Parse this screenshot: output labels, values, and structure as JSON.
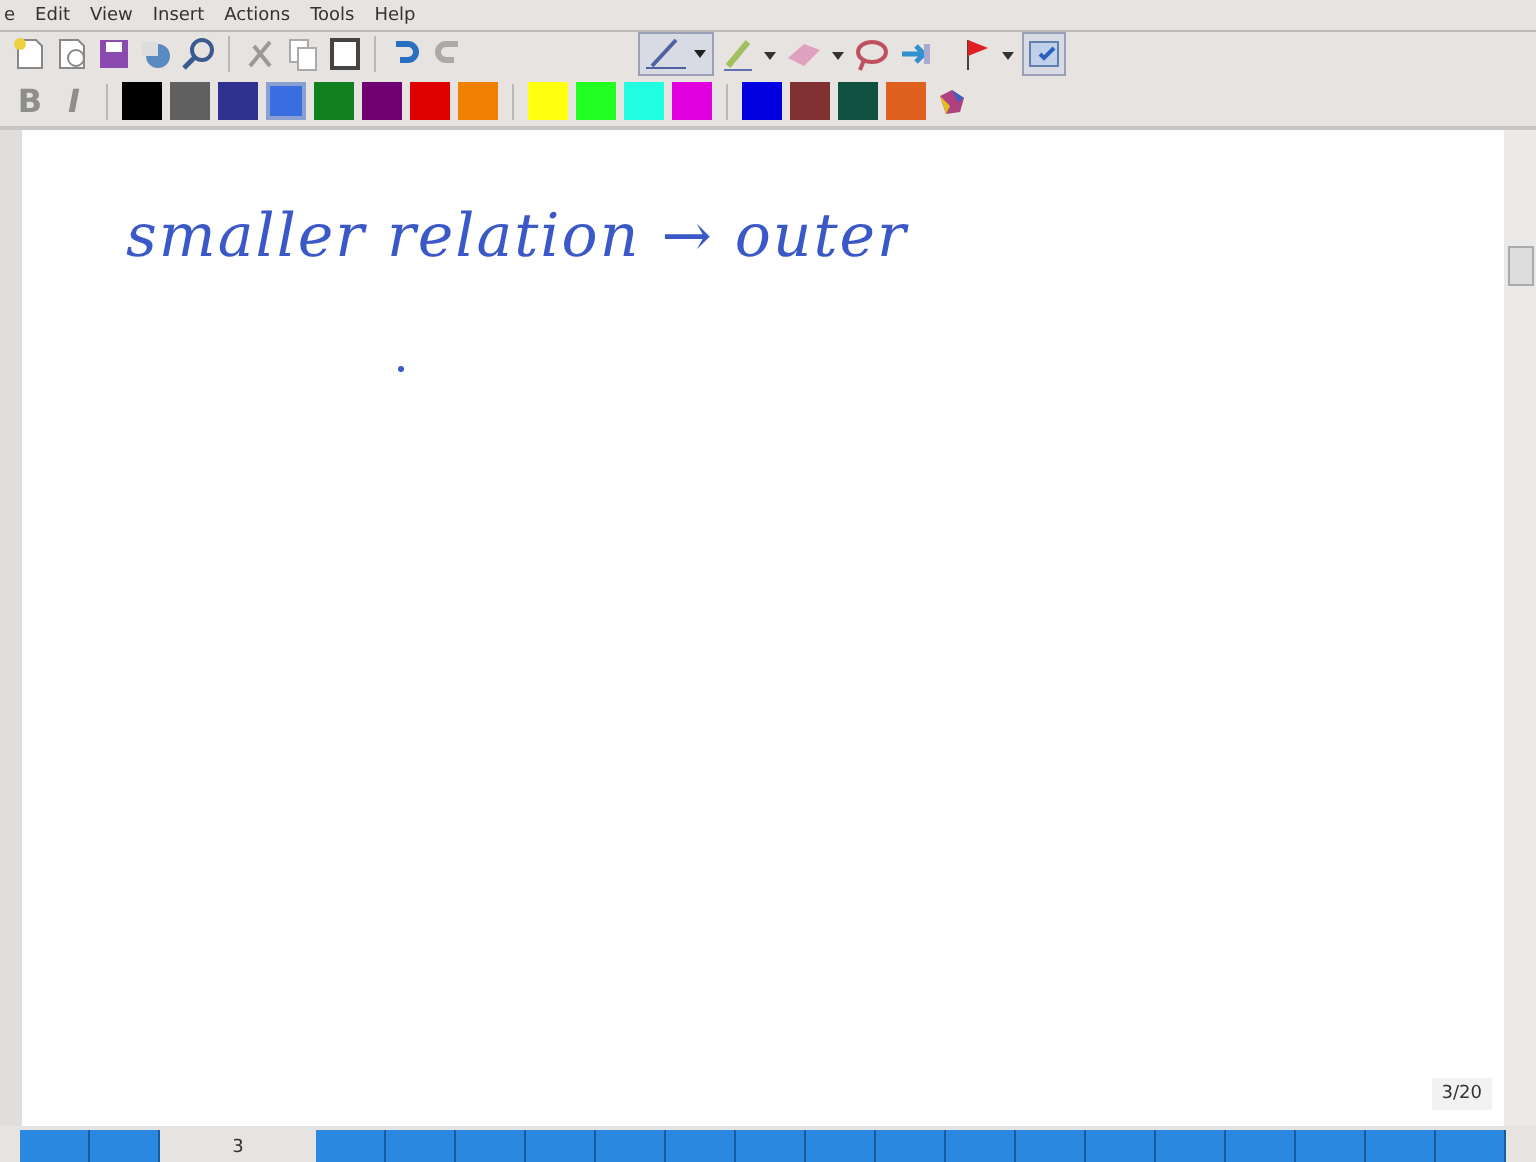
{
  "menu": [
    {
      "label": "e"
    },
    {
      "label": "Edit"
    },
    {
      "label": "View"
    },
    {
      "label": "Insert"
    },
    {
      "label": "Actions"
    },
    {
      "label": "Tools"
    },
    {
      "label": "Help"
    }
  ],
  "format": [
    {
      "label": "B",
      "kind": "bold",
      "disabled": true
    },
    {
      "label": "I",
      "kind": "italic",
      "disabled": true
    }
  ],
  "palette": [
    {
      "color": "#000000",
      "selected": false
    },
    {
      "color": "#606060",
      "selected": false
    },
    {
      "color": "#303090",
      "selected": false
    },
    {
      "color": "#3a6ee0",
      "selected": true
    },
    {
      "color": "#108020",
      "selected": false
    },
    {
      "color": "#700070",
      "selected": false
    },
    {
      "color": "#e00000",
      "selected": false
    },
    {
      "color": "#f08000",
      "selected": false
    },
    {
      "color": "#ffff10",
      "selected": false
    },
    {
      "color": "#20ff20",
      "selected": false
    },
    {
      "color": "#20ffe0",
      "selected": false
    },
    {
      "color": "#e000e0",
      "selected": false
    },
    {
      "color": "#0000e0",
      "selected": false
    },
    {
      "color": "#803030",
      "selected": false
    },
    {
      "color": "#105040",
      "selected": false
    },
    {
      "color": "#e06020",
      "selected": false
    }
  ],
  "ink": {
    "text": "smaller relation → outer",
    "color": "#3a58c8"
  },
  "page_indicator": "3/20",
  "pages": [
    {
      "selected": false
    },
    {
      "selected": false
    },
    {
      "selected": true,
      "label": "3"
    },
    {
      "selected": false
    },
    {
      "selected": false
    },
    {
      "selected": false
    },
    {
      "selected": false
    },
    {
      "selected": false
    },
    {
      "selected": false
    },
    {
      "selected": false
    },
    {
      "selected": false
    },
    {
      "selected": false
    },
    {
      "selected": false
    },
    {
      "selected": false
    },
    {
      "selected": false
    },
    {
      "selected": false
    },
    {
      "selected": false
    },
    {
      "selected": false
    },
    {
      "selected": false
    },
    {
      "selected": false
    }
  ]
}
